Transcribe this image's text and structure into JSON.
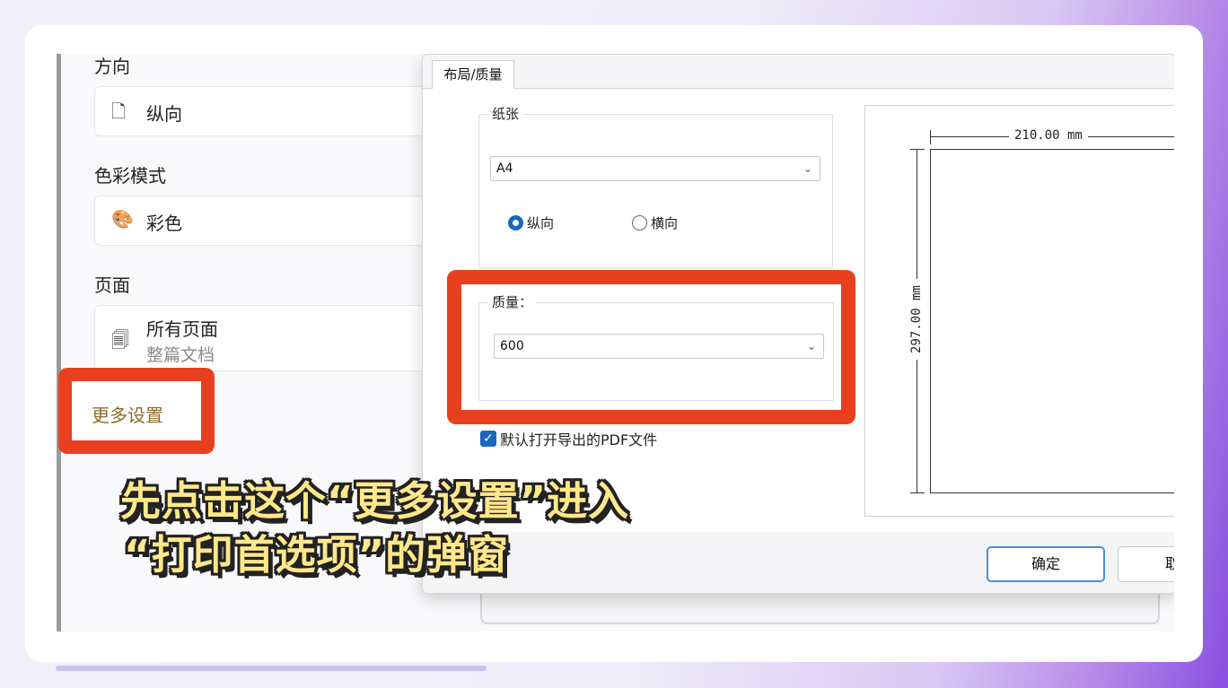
{
  "left_panel": {
    "orientation_label": "方向",
    "orientation_value": "纵向",
    "color_label": "色彩模式",
    "color_value": "彩色",
    "pages_label": "页面",
    "pages_value": "所有页面",
    "pages_sub": "整篇文档",
    "more_settings": "更多设置"
  },
  "dialog": {
    "tab": "布局/质量",
    "paper_group": "纸张",
    "paper_size": "A4",
    "portrait": "纵向",
    "landscape": "横向",
    "quality_group": "质量：",
    "quality_value": "600",
    "open_pdf_checkbox": "默认打开导出的PDF文件",
    "preview_width": "210.00 mm",
    "preview_height": "297.00 mm",
    "ok": "确定",
    "cancel": "取"
  },
  "subtitle": {
    "line1": "先点击这个“更多设置”进入",
    "line2": "“打印首选项”的弹窗"
  },
  "colors": {
    "highlight": "#e8401f",
    "subtitle": "#ffe88a",
    "accent": "#1a67c0"
  }
}
